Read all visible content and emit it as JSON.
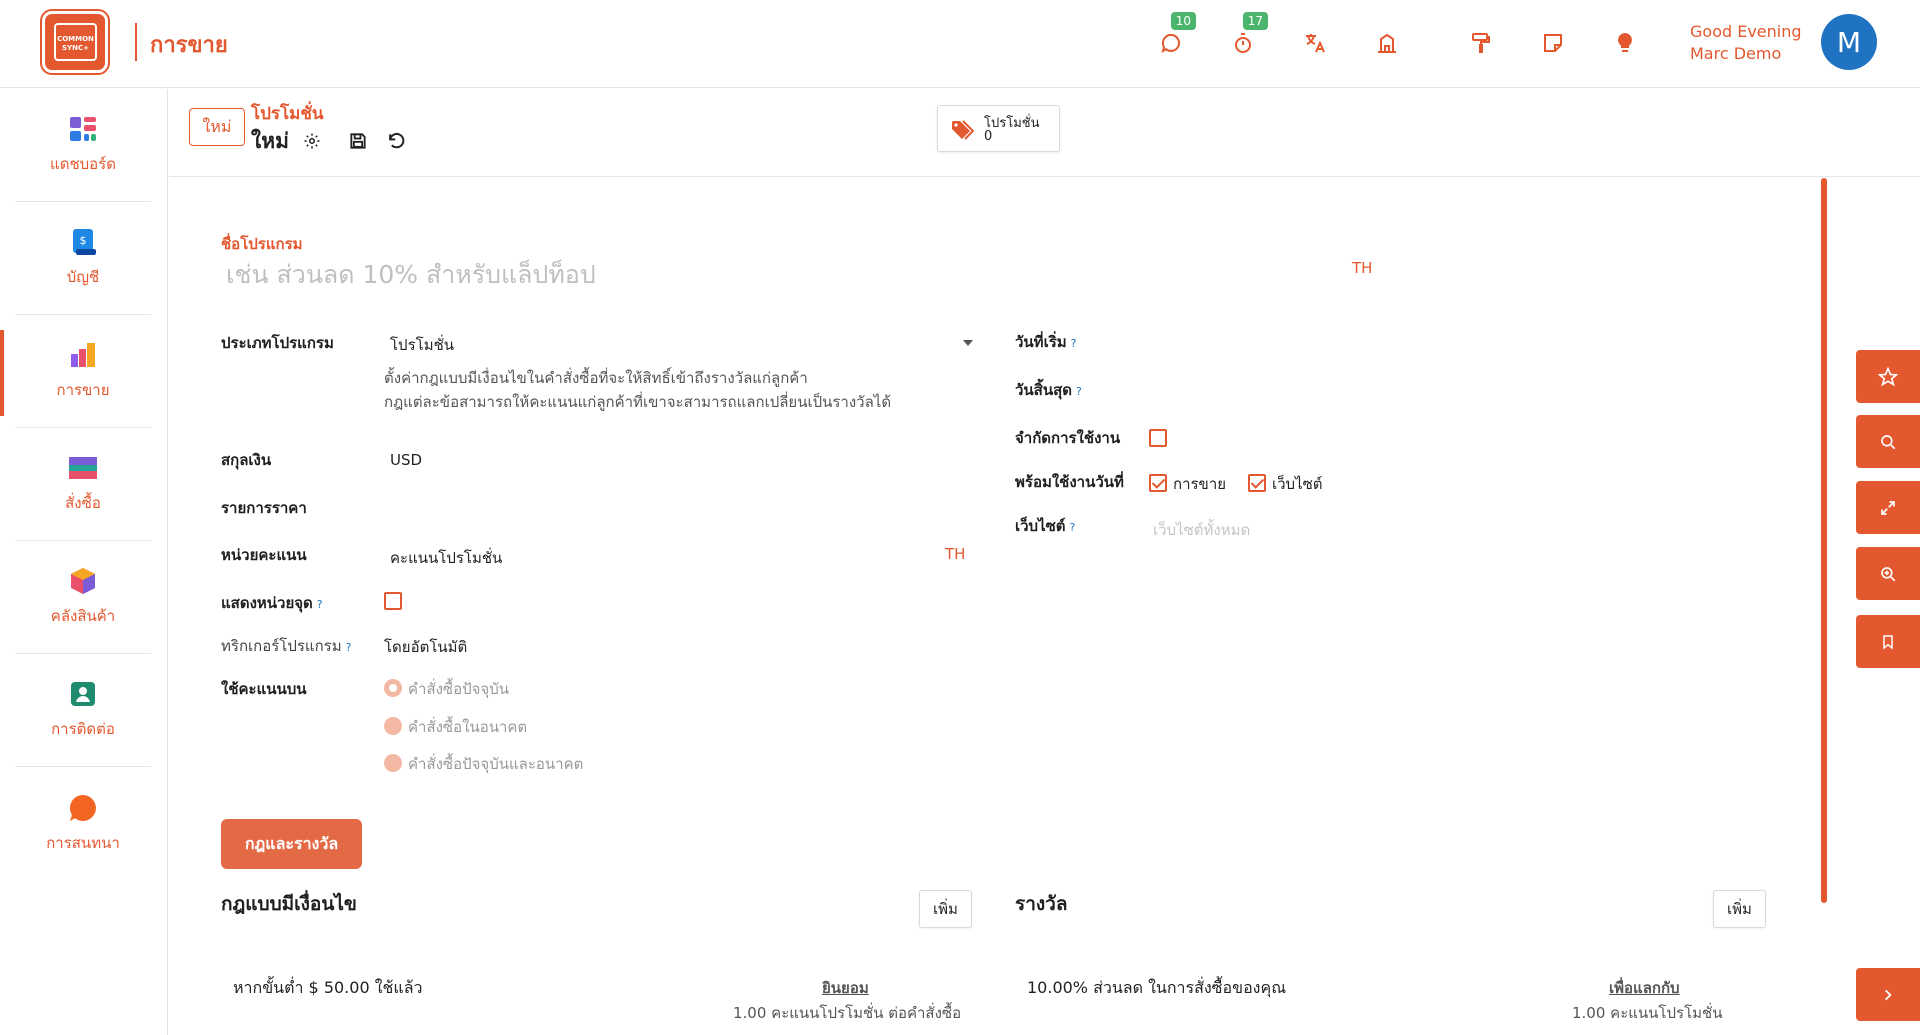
{
  "app": {
    "logo_text": "COMMON SYNC+",
    "title": "การขาย"
  },
  "topbar": {
    "messages_badge": "10",
    "activities_badge": "17",
    "greeting_line1": "Good Evening",
    "greeting_line2": "Marc Demo",
    "avatar_initial": "M"
  },
  "sidebar": {
    "items": [
      {
        "label": "แดชบอร์ด",
        "icon": "dashboard-icon"
      },
      {
        "label": "บัญชี",
        "icon": "accounting-icon"
      },
      {
        "label": "การขาย",
        "icon": "sales-icon"
      },
      {
        "label": "สั่งซื้อ",
        "icon": "purchase-icon"
      },
      {
        "label": "คลังสินค้า",
        "icon": "inventory-icon"
      },
      {
        "label": "การติดต่อ",
        "icon": "contacts-icon"
      },
      {
        "label": "การสนทนา",
        "icon": "discuss-icon"
      }
    ]
  },
  "control_panel": {
    "new_label": "ใหม่",
    "breadcrumb_parent": "โปรโมชั่น",
    "breadcrumb_current": "ใหม่",
    "smart_button_label": "โปรโมชั่น",
    "smart_button_count": "0"
  },
  "form": {
    "program_name_label": "ชื่อโปรแกรม",
    "program_name_placeholder": "เช่น ส่วนลด 10% สำหรับแล็ปท็อป",
    "lang_tag": "TH",
    "program_type_label": "ประเภทโปรแกรม",
    "program_type_value": "โปรโมชั่น",
    "program_type_help_1": "ตั้งค่ากฎแบบมีเงื่อนไขในคำสั่งซื้อที่จะให้สิทธิ์เข้าถึงรางวัลแก่ลูกค้า",
    "program_type_help_2": "กฎแต่ละข้อสามารถให้คะแนนแก่ลูกค้าที่เขาจะสามารถแลกเปลี่ยนเป็นรางวัลได้",
    "currency_label": "สกุลเงิน",
    "currency_value": "USD",
    "pricelist_label": "รายการราคา",
    "point_unit_label": "หน่วยคะแนน",
    "point_unit_value": "คะแนนโปรโมชั่น",
    "point_unit_lang": "TH",
    "show_points_label": "แสดงหน่วยจุด",
    "trigger_label": "ทริกเกอร์โปรแกรม",
    "trigger_value": "โดยอัตโนมัติ",
    "apply_on_label": "ใช้คะแนนบน",
    "apply_options": [
      "คำสั่งซื้อปัจจุบัน",
      "คำสั่งซื้อในอนาคต",
      "คำสั่งซื้อปัจจุบันและอนาคต"
    ],
    "start_date_label": "วันที่เริ่ม",
    "end_date_label": "วันสิ้นสุด",
    "limit_usage_label": "จำกัดการใช้งาน",
    "available_on_label": "พร้อมใช้งานวันที่",
    "available_sales_label": "การขาย",
    "available_website_label": "เว็บไซต์",
    "website_label": "เว็บไซต์",
    "website_placeholder": "เว็บไซต์ทั้งหมด",
    "help_mark": "?"
  },
  "rules_section": {
    "tab_label": "กฎและรางวัล",
    "rules_title": "กฎแบบมีเงื่อนไข",
    "rules_add": "เพิ่ม",
    "rule_text": "หากขั้นต่ำ $ 50.00 ใช้แล้ว",
    "rule_link": "ยินยอม",
    "rule_sub": "1.00 คะแนนโปรโมชั่น ต่อคำสั่งซื้อ",
    "rewards_title": "รางวัล",
    "rewards_add": "เพิ่ม",
    "reward_text": "10.00% ส่วนลด ในการสั่งซื้อของคุณ",
    "reward_link": "เพื่อแลกกับ",
    "reward_sub": "1.00 คะแนนโปรโมชั่น"
  },
  "colors": {
    "accent": "#e4582f",
    "avatar": "#1f73c2",
    "badge": "#4cb56d"
  }
}
